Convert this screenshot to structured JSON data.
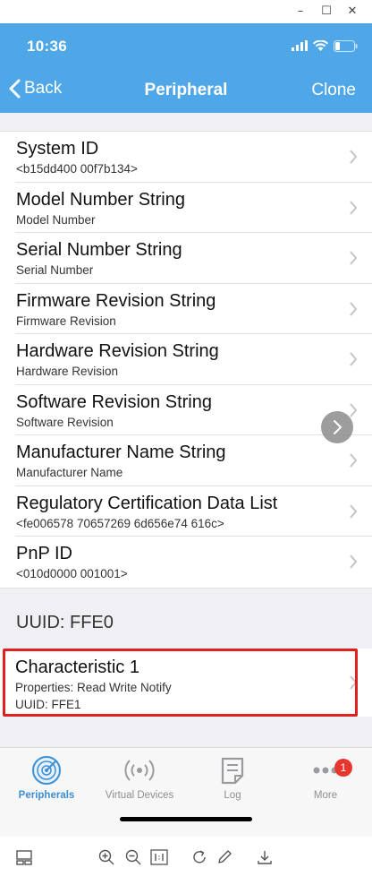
{
  "window": {
    "minimize_glyph": "–",
    "maximize_glyph": "☐",
    "close_glyph": "✕"
  },
  "status_bar": {
    "time": "10:36",
    "icons": [
      "signal-icon",
      "wifi-icon",
      "battery-icon"
    ]
  },
  "nav": {
    "back_label": "Back",
    "title": "Peripheral",
    "right_label": "Clone"
  },
  "services": [
    {
      "title": "System ID",
      "subtitle": "<b15dd400 00f7b134>"
    },
    {
      "title": "Model Number String",
      "subtitle": "Model Number"
    },
    {
      "title": "Serial Number String",
      "subtitle": "Serial Number"
    },
    {
      "title": "Firmware Revision String",
      "subtitle": "Firmware Revision"
    },
    {
      "title": "Hardware Revision String",
      "subtitle": "Hardware Revision"
    },
    {
      "title": "Software Revision String",
      "subtitle": "Software Revision"
    },
    {
      "title": "Manufacturer Name String",
      "subtitle": "Manufacturer Name"
    },
    {
      "title": "Regulatory Certification Data List",
      "subtitle": "<fe006578 70657269 6d656e74 616c>"
    },
    {
      "title": "PnP ID",
      "subtitle": "<010d0000 001001>"
    }
  ],
  "section": {
    "uuid_header": "UUID: FFE0"
  },
  "characteristic": {
    "title": "Characteristic 1",
    "properties": "Properties: Read Write Notify",
    "uuid": "UUID: FFE1"
  },
  "tabs": [
    {
      "label": "Peripherals",
      "icon": "radar-icon",
      "active": true
    },
    {
      "label": "Virtual Devices",
      "icon": "broadcast-icon",
      "active": false
    },
    {
      "label": "Log",
      "icon": "log-icon",
      "active": false
    },
    {
      "label": "More",
      "icon": "more-icon",
      "active": false,
      "badge": "1"
    }
  ],
  "colors": {
    "header_bg": "#4fa7e7",
    "accent": "#3d8fd6",
    "highlight": "#e02020",
    "badge": "#e8362f"
  },
  "toolbar_icons": [
    "layout-icon",
    "zoom-in-icon",
    "zoom-out-icon",
    "actual-size-icon",
    "rotate-icon",
    "edit-icon",
    "download-icon"
  ]
}
